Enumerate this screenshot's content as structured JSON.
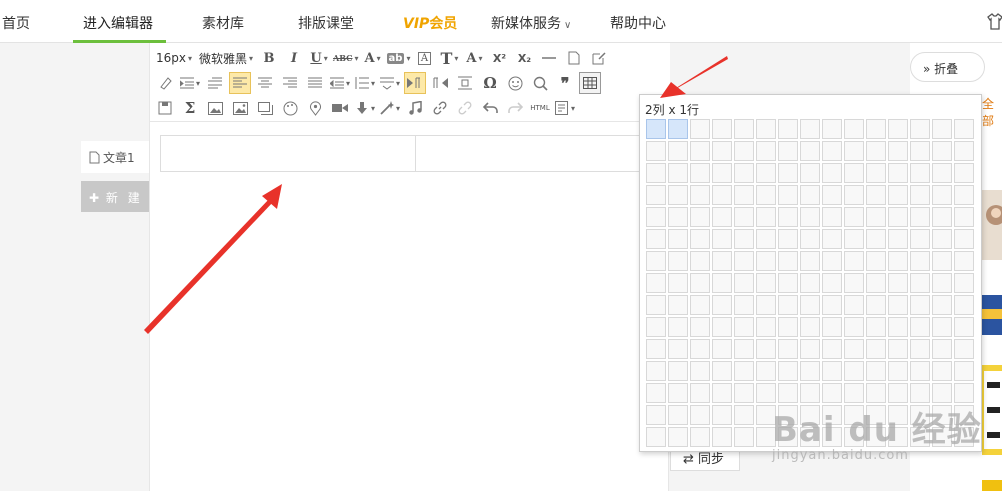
{
  "nav": {
    "home": "首页",
    "editor": "进入编辑器",
    "materials": "素材库",
    "classroom": "排版课堂",
    "vip_prefix": "VIP",
    "vip_suffix": "会员",
    "media_service": "新媒体服务",
    "help": "帮助中心"
  },
  "sidebar": {
    "article_tab": "文章1",
    "new_button": "新 建"
  },
  "toolbar": {
    "font_size": "16px",
    "font_family": "微软雅黑",
    "bold": "B",
    "italic": "I",
    "underline": "U",
    "abc": "ABC",
    "font_color": "A",
    "highlight": "ab",
    "border_text": "A",
    "text_t": "T",
    "superscript": "X²",
    "subscript": "X₂",
    "omega": "Ω",
    "html": "HTML"
  },
  "table_popup": {
    "selection_label": "2列 x 1行",
    "rows": 15,
    "cols": 15,
    "selected_cols": 2,
    "selected_rows": 1
  },
  "right_panel": {
    "fold_button": "折叠",
    "all_label": "全部",
    "sync_button": "同步"
  },
  "watermark": {
    "main": "Bai du 经验",
    "sub": "jingyan.baidu.com"
  },
  "colors": {
    "accent_green": "#6cbf3c",
    "vip_gold": "#f0a400",
    "arrow_red": "#e8322a",
    "grid_selected": "#d6e6fa"
  }
}
